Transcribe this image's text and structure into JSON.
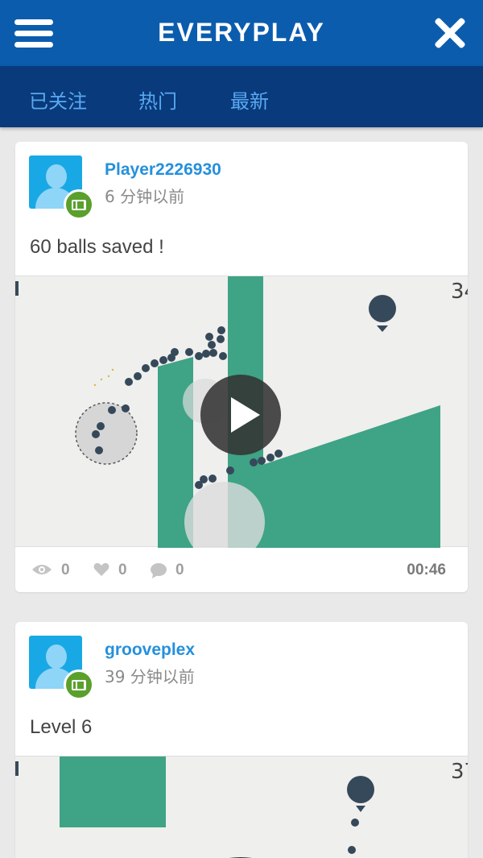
{
  "header": {
    "title": "EVERYPLAY",
    "menu_icon": "hamburger-menu-icon",
    "close_icon": "close-icon",
    "colors": {
      "topbar": "#0b5cad",
      "tabbar": "#083a7c",
      "tab_text": "#5aa9f0"
    }
  },
  "tabs": [
    {
      "label": "已关注"
    },
    {
      "label": "热门"
    },
    {
      "label": "最新"
    }
  ],
  "posts": [
    {
      "username": "Player2226930",
      "time": "6 分钟以前",
      "caption": "60 balls saved !",
      "score_fragment": "34",
      "stats": {
        "views": "0",
        "likes": "0",
        "comments": "0"
      },
      "duration": "00:46",
      "badge_icon": "video-film-icon"
    },
    {
      "username": "grooveplex",
      "time": "39 分钟以前",
      "caption": "Level 6",
      "score_fragment": "37",
      "badge_icon": "video-film-icon"
    }
  ],
  "colors": {
    "accent": "#2590dc",
    "game_green": "#3fa386",
    "ball": "#36495a"
  }
}
